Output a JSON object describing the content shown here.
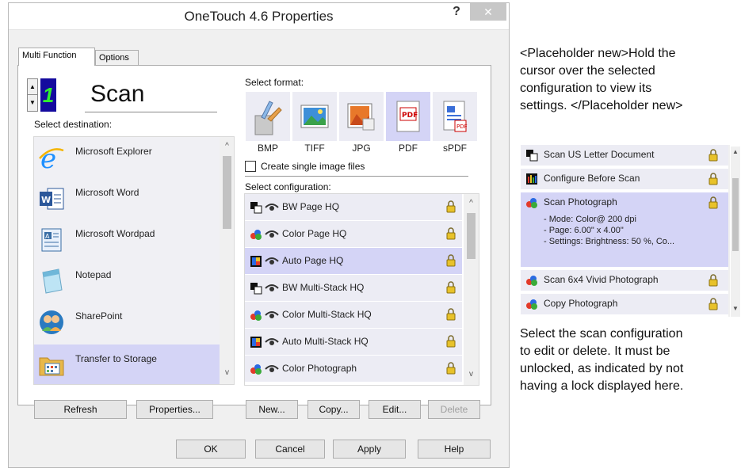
{
  "window": {
    "title": "OneTouch 4.6 Properties",
    "help_label": "?",
    "close_label": "✕"
  },
  "tabs": [
    {
      "label": "Multi Function",
      "active": true
    },
    {
      "label": "Options",
      "active": false
    }
  ],
  "button_number": "1",
  "button_name": "Scan",
  "destination": {
    "label": "Select destination:",
    "items": [
      {
        "label": "Microsoft Explorer",
        "icon": "internet-explorer-icon",
        "selected": false
      },
      {
        "label": "Microsoft Word",
        "icon": "word-icon",
        "selected": false
      },
      {
        "label": "Microsoft Wordpad",
        "icon": "wordpad-icon",
        "selected": false
      },
      {
        "label": "Notepad",
        "icon": "notepad-icon",
        "selected": false
      },
      {
        "label": "SharePoint",
        "icon": "sharepoint-icon",
        "selected": false
      },
      {
        "label": "Transfer to Storage",
        "icon": "storage-folder-icon",
        "selected": true
      }
    ]
  },
  "format": {
    "label": "Select format:",
    "items": [
      {
        "label": "BMP",
        "icon": "bmp-icon",
        "selected": false
      },
      {
        "label": "TIFF",
        "icon": "tiff-icon",
        "selected": false
      },
      {
        "label": "JPG",
        "icon": "jpg-icon",
        "selected": false
      },
      {
        "label": "PDF",
        "icon": "pdf-icon",
        "selected": true
      },
      {
        "label": "sPDF",
        "icon": "spdf-icon",
        "selected": false
      }
    ]
  },
  "single_image": {
    "label": "Create single image files",
    "checked": false
  },
  "configuration": {
    "label": "Select configuration:",
    "items": [
      {
        "label": "BW Page HQ",
        "icon": "bw-page-icon",
        "selected": false
      },
      {
        "label": "Color Page HQ",
        "icon": "color-page-icon",
        "selected": false
      },
      {
        "label": "Auto Page HQ",
        "icon": "auto-page-icon",
        "selected": true
      },
      {
        "label": "BW Multi-Stack HQ",
        "icon": "bw-page-icon",
        "selected": false
      },
      {
        "label": "Color Multi-Stack HQ",
        "icon": "color-page-icon",
        "selected": false
      },
      {
        "label": "Auto Multi-Stack HQ",
        "icon": "auto-page-icon",
        "selected": false
      },
      {
        "label": "Color Photograph",
        "icon": "color-page-icon",
        "selected": false
      }
    ]
  },
  "buttons": {
    "refresh": "Refresh",
    "properties": "Properties...",
    "new": "New...",
    "copy": "Copy...",
    "edit": "Edit...",
    "delete": "Delete",
    "ok": "OK",
    "cancel": "Cancel",
    "apply": "Apply",
    "help": "Help"
  },
  "note_top": {
    "lines": [
      "<Placeholder new>Hold the",
      "cursor over the selected",
      "configuration to view its",
      "settings. </Placeholder new>"
    ]
  },
  "mini_list": {
    "items": [
      {
        "label": "Scan US Letter Document",
        "icon": "bw-page-icon"
      },
      {
        "label": "Configure Before Scan",
        "icon": "configure-icon"
      },
      {
        "label": "Scan Photograph",
        "icon": "color-page-icon",
        "details": [
          "- Mode: Color@ 200 dpi",
          "- Page:  6.00\" x  4.00\"",
          "- Settings: Brightness: 50 %, Co..."
        ]
      },
      {
        "label": "Scan 6x4 Vivid Photograph",
        "icon": "color-page-icon"
      },
      {
        "label": "Copy Photograph",
        "icon": "color-page-icon"
      }
    ]
  },
  "note_bottom": {
    "lines": [
      "Select the scan configuration",
      "to edit or delete. It must be",
      "unlocked, as indicated by not",
      "having a lock displayed here."
    ]
  },
  "colors": {
    "selected_bg": "#d4d4f6",
    "item_bg": "#ececf4",
    "lcd_bg": "#140a9e",
    "lcd_fg": "#2ff02f",
    "lock": "#e8c22a"
  }
}
